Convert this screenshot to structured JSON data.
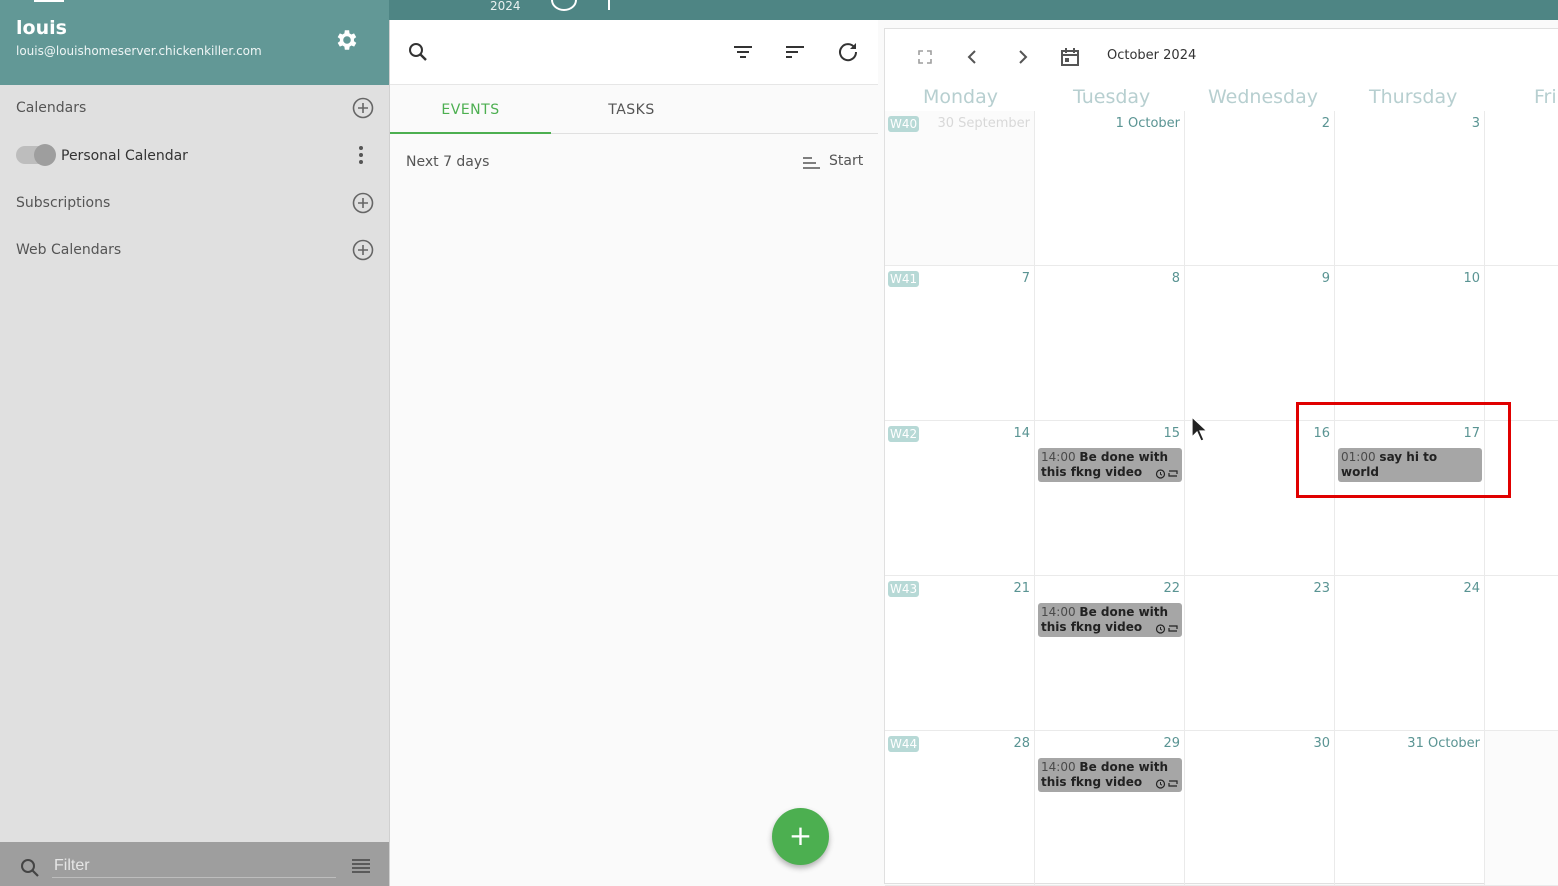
{
  "topbar": {
    "year": "2024"
  },
  "account": {
    "name": "louis",
    "email": "louis@louishomeserver.chickenkiller.com"
  },
  "sidebar": {
    "sections": [
      {
        "label": "Calendars"
      },
      {
        "label": "Subscriptions"
      },
      {
        "label": "Web Calendars"
      }
    ],
    "calendars": [
      {
        "label": "Personal Calendar",
        "enabled": true
      }
    ],
    "filter": {
      "placeholder": "Filter",
      "value": ""
    }
  },
  "agenda": {
    "tabs": [
      {
        "label": "EVENTS",
        "active": true
      },
      {
        "label": "TASKS",
        "active": false
      }
    ],
    "range_label": "Next 7 days",
    "sort_label": "Start",
    "fab_label": "+"
  },
  "calendar": {
    "month_label": "October 2024",
    "weekdays": [
      "Monday",
      "Tuesday",
      "Wednesday",
      "Thursday",
      "Fri"
    ],
    "weeks": [
      {
        "week": "W40",
        "days": [
          "30 September",
          "1 October",
          "2",
          "3",
          ""
        ]
      },
      {
        "week": "W41",
        "days": [
          "7",
          "8",
          "9",
          "10",
          ""
        ]
      },
      {
        "week": "W42",
        "days": [
          "14",
          "15",
          "16",
          "17",
          ""
        ]
      },
      {
        "week": "W43",
        "days": [
          "21",
          "22",
          "23",
          "24",
          ""
        ]
      },
      {
        "week": "W44",
        "days": [
          "28",
          "29",
          "30",
          "31 October",
          ""
        ]
      }
    ],
    "events": [
      {
        "week": 2,
        "day": 1,
        "time": "14:00",
        "title": "Be done with this fkng video",
        "alarm": true,
        "repeat": true
      },
      {
        "week": 2,
        "day": 3,
        "time": "01:00",
        "title": "say hi to world",
        "alarm": false,
        "repeat": false
      },
      {
        "week": 3,
        "day": 1,
        "time": "14:00",
        "title": "Be done with this fkng video",
        "alarm": true,
        "repeat": true
      },
      {
        "week": 4,
        "day": 1,
        "time": "14:00",
        "title": "Be done with this fkng video",
        "alarm": true,
        "repeat": true
      }
    ],
    "colors": {
      "header": "#629896",
      "event_bg": "#a6a6a6",
      "highlight": "#e00000",
      "accent": "#4caf50"
    }
  }
}
